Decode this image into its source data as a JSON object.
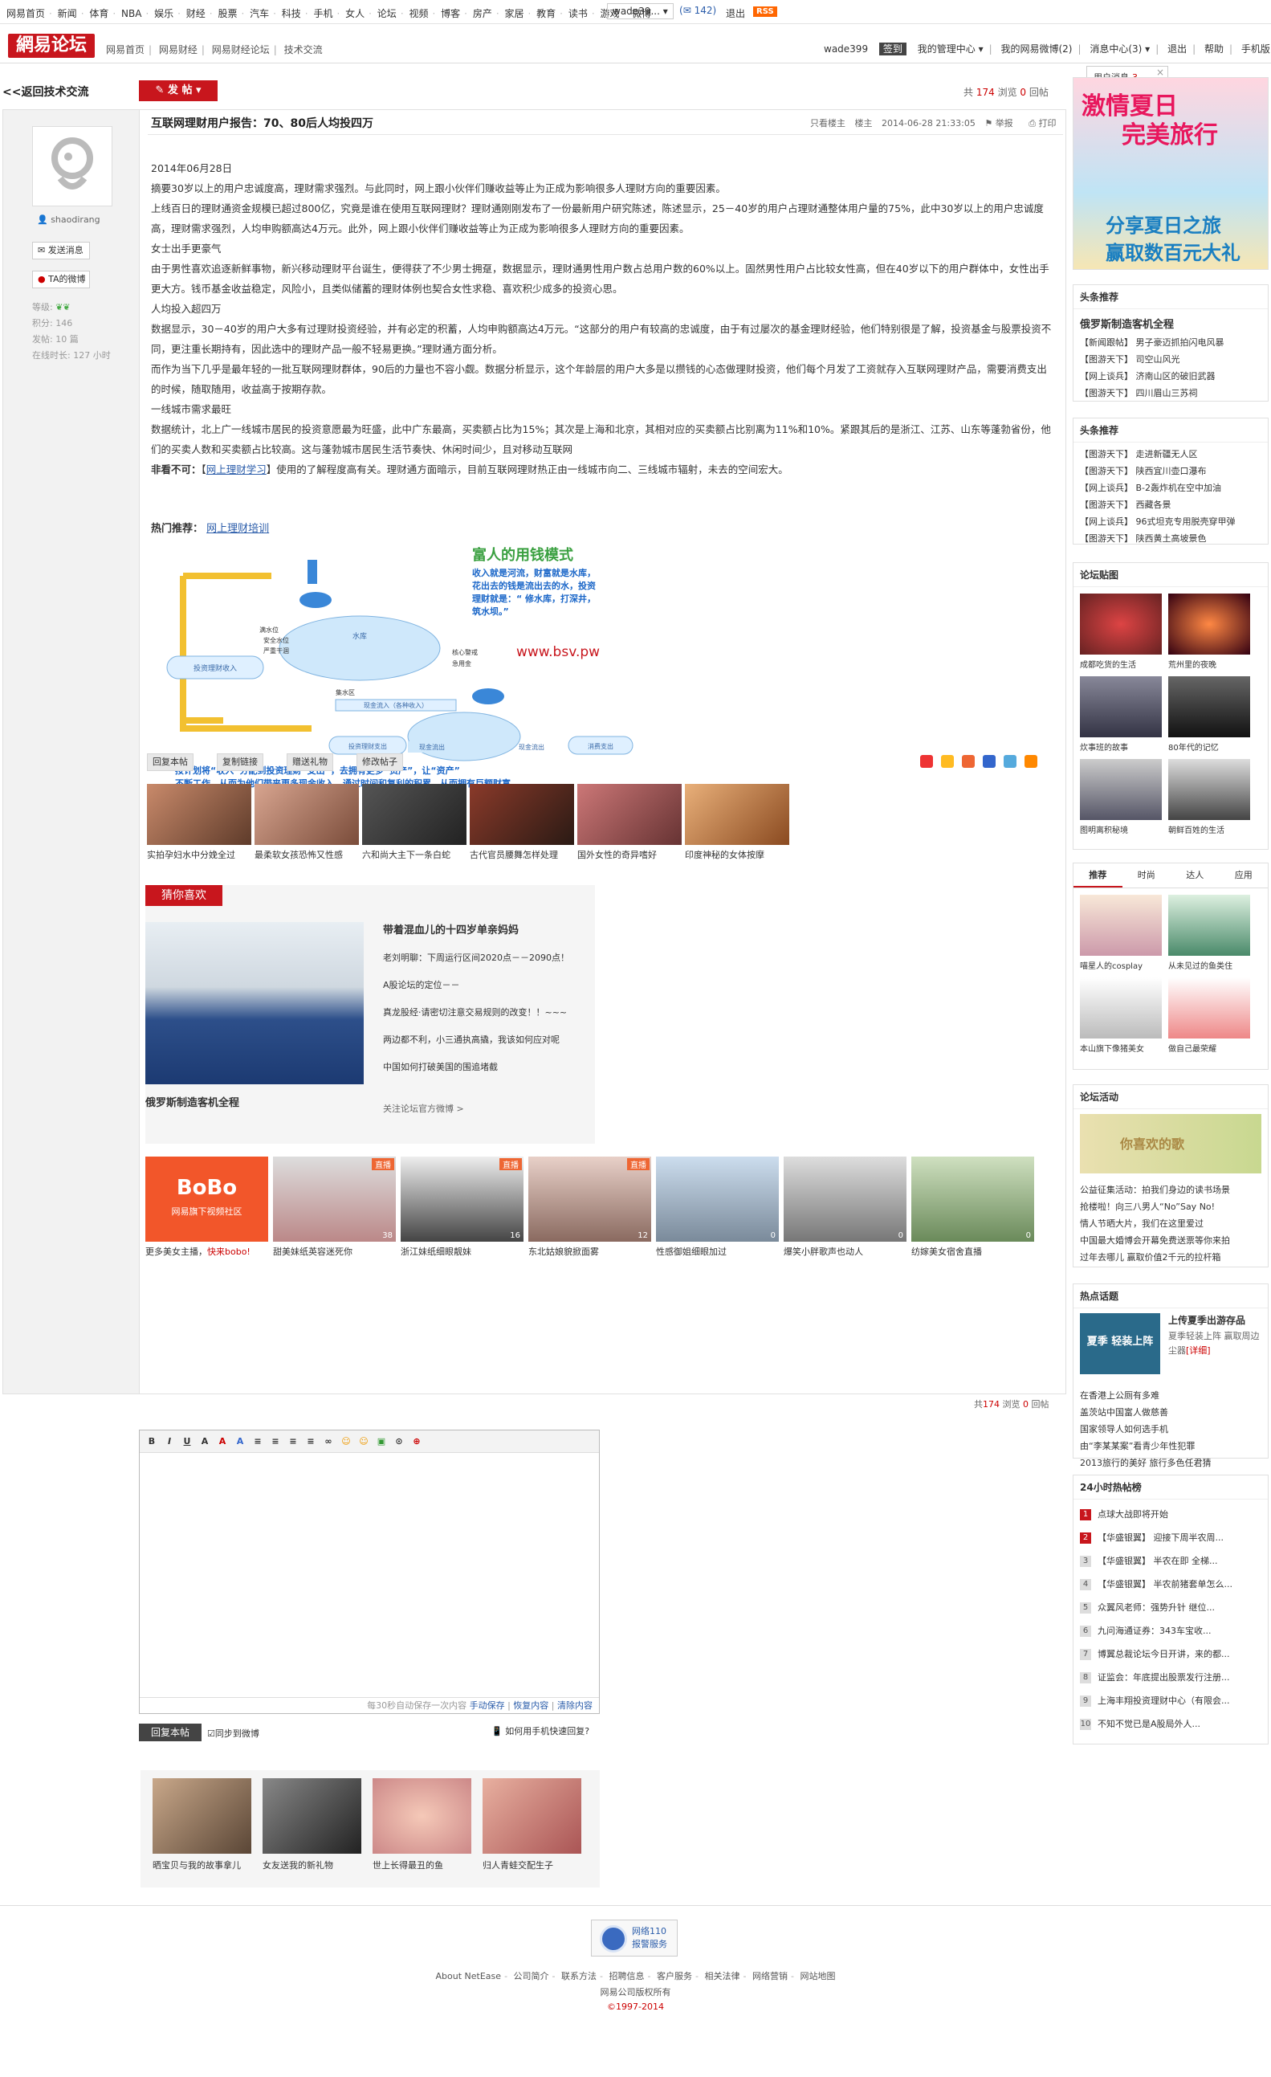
{
  "topnav": {
    "links": [
      "网易首页",
      "新闻",
      "体育",
      "NBA",
      "娱乐",
      "财经",
      "股票",
      "汽车",
      "科技",
      "手机",
      "女人",
      "论坛",
      "视频",
      "博客",
      "房产",
      "家居",
      "教育",
      "读书",
      "游戏",
      "微博"
    ],
    "user": "wade39...",
    "mail_count": "142",
    "logout": "退出",
    "rss": "RSS"
  },
  "header": {
    "logo": "網易论坛",
    "breadcrumb": [
      "网易首页",
      "网易财经",
      "网易财经论坛",
      "技术交流"
    ],
    "username": "wade399",
    "sign_badge": "签到",
    "menu": [
      "我的管理中心",
      "我的网易微博(2)",
      "消息中心(3)",
      "退出",
      "帮助",
      "手机版"
    ]
  },
  "msgpop": {
    "label": "用户消息",
    "count": "3",
    "close": "×"
  },
  "toolbar": {
    "back": "<<返回技术交流",
    "post": "发 帖"
  },
  "stats": {
    "total_label": "共",
    "views": "174",
    "views_label": "浏览",
    "replies": "0",
    "replies_label": "回帖"
  },
  "post": {
    "title": "互联网理财用户报告：70、80后人均投四万",
    "meta": {
      "only_author": "只看楼主",
      "floor": "楼主",
      "time": "2014-06-28 21:33:05",
      "report": "举报",
      "print": "打印"
    },
    "author": {
      "name": "shaodirang",
      "send_msg": "发送消息",
      "weibo": "TA的微博",
      "level_label": "等级:",
      "points_label": "积分:",
      "points": "146",
      "posts_label": "发帖:",
      "posts": "10 篇",
      "online_label": "在线时长:",
      "online": "127 小时"
    },
    "paragraphs": [
      "2014年06月28日",
      "摘要30岁以上的用户忠诚度高，理财需求强烈。与此同时，网上跟小伙伴们赚收益等止为正成为影响很多人理财方向的重要因素。",
      "上线百日的理财通资金规模已超过800亿，究竟是谁在使用互联网理财？理财通刚刚发布了一份最新用户研究陈述，陈述显示，25－40岁的用户占理财通整体用户量的75%，此中30岁以上的用户忠诚度高，理财需求强烈，人均申购额高达4万元。此外，网上跟小伙伴们赚收益等止为正成为影响很多人理财方向的重要因素。",
      "女士出手更豪气",
      "由于男性喜欢追逐新鲜事物，新兴移动理财平台诞生，便得获了不少男士拥趸，数据显示，理财通男性用户数占总用户数的60%以上。固然男性用户占比较女性高，但在40岁以下的用户群体中，女性出手更大方。钱币基金收益稳定，风险小，且类似储蓄的理财体例也契合女性求稳、喜欢积少成多的投资心思。",
      "人均投入超四万",
      "数据显示，30－40岁的用户大多有过理财投资经验，并有必定的积蓄，人均申购额高达4万元。“这部分的用户有较高的忠诚度，由于有过屡次的基金理财经验，他们特别很是了解，投资基金与股票投资不同，更注重长期持有，因此选中的理财产品一般不轻易更换。”理财通方面分析。",
      "而作为当下几乎是最年轻的一批互联网理财群体，90后的力量也不容小觑。数据分析显示，这个年龄层的用户大多是以攒钱的心态做理财投资，他们每个月发了工资就存入互联网理财产品，需要消费支出的时候，随取随用，收益高于按期存款。",
      "一线城市需求最旺",
      "数据统计，北上广一线城市居民的投资意愿最为旺盛，此中广东最高，买卖额占比为15%；其次是上海和北京，其相对应的买卖额占比别离为11%和10%。紧跟其后的是浙江、江苏、山东等蓬勃省份，他们的买卖人数和买卖额占比较高。这与蓬勃城市居民生活节奏快、休闲时间少，且对移动互联网"
    ],
    "closing": {
      "label": "非看不可：",
      "link": "网上理财学习",
      "rest": "】使用的了解程度高有关。理财通方面暗示，目前互联网理财热正由一线城市向二、三线城市辐射，未去的空间宏大。"
    },
    "hot": {
      "label": "热门推荐：",
      "link": "网上理财培训"
    },
    "infographic": {
      "heading": "富人的用钱模式",
      "lines": [
        "收入就是河流，财富就是水库，",
        "花出去的钱是流出去的水，投资",
        "理财就是：“ 修水库，打深井，",
        "筑水坝。”"
      ],
      "watermark": "www.bsv.pw",
      "boxes": [
        "投资理财收入",
        "水库",
        "现金流入（各种收入）",
        "投资理财支出",
        "现金流出",
        "消费支出"
      ],
      "side_labels": [
        "满水位",
        "安全水位",
        "严重干涸",
        "核心警戒",
        "急用金",
        "集水区",
        "现金流出"
      ],
      "bottom": [
        "按计划将“收入”分配到投资理财“支出”，去拥有更多“资产”，让“资产”",
        "不断工作，从而为他们带来更多现金收入，通过时间和复利的积累，从而拥有巨额财富。"
      ]
    },
    "actions": [
      "回复本帖",
      "复制链接",
      "赠送礼物",
      "修改帖子"
    ]
  },
  "pic_row": [
    "实拍孕妇水中分娩全过",
    "最柔软女孩恐怖又性感",
    "六和尚大主下一条白蛇",
    "古代官员腰舞怎样处理",
    "国外女性的奇异嗜好",
    "印度神秘的女体按摩"
  ],
  "guess": {
    "tab": "猜你喜欢",
    "caption": "俄罗斯制造客机全程",
    "headline": "带着混血儿的十四岁单亲妈妈",
    "items": [
      "老刘明聊：下周运行区间2020点－－2090点！",
      "A股论坛的定位－－",
      "真龙股经·请密切注意交易规则的改变！！~~~",
      "两边都不利，小三通执高撬，我该如何应对呢",
      "中国如何打破美国的围追堵截"
    ],
    "follow": "关注论坛官方微博 >"
  },
  "live_row": [
    {
      "cap_a": "更多美女主播，",
      "cap_b": "快来bobo!",
      "logo": "BoBo",
      "sub": "网易旗下视频社区"
    },
    {
      "cap_a": "甜美妹纸英容迷死你",
      "badge": "直播",
      "cnt": "38"
    },
    {
      "cap_a": "浙江妹纸细眼靓妹",
      "badge": "直播",
      "cnt": "16"
    },
    {
      "cap_a": "东北姑娘貌掀面雾",
      "badge": "直播",
      "cnt": "12"
    },
    {
      "cap_a": "性感御姐细眼加过",
      "cnt": "0"
    },
    {
      "cap_a": "爆笑小胖歌声也动人",
      "cnt": "0"
    },
    {
      "cap_a": "纺嫁美女宿舍直播",
      "cnt": "0"
    }
  ],
  "editor": {
    "tools": [
      "B",
      "I",
      "U",
      "A",
      "A",
      "A",
      "≡",
      "≡",
      "≡",
      "≡",
      "∞",
      "☺",
      "☺",
      "▣",
      "⊙",
      "⊕"
    ],
    "autosave": "每30秒自动保存一次内容",
    "save": "手动保存",
    "restore": "恢复内容",
    "clear": "清除内容",
    "reply": "回复本帖",
    "sync": "同步到微博",
    "mobile": "如何用手机快速回复?"
  },
  "related": [
    "晒宝贝与我的故事拿儿",
    "女友送我的新礼物",
    "世上长得最丑的鱼",
    "归人青蛙交配生子"
  ],
  "footer": {
    "police_line1": "网络110",
    "police_line2": "报警服务",
    "links": [
      "About NetEase",
      "公司简介",
      "联系方法",
      "招聘信息",
      "客户服务",
      "相关法律",
      "网络营销",
      "网站地图"
    ],
    "copy": "网易公司版权所有",
    "year": "©1997-2014"
  },
  "sidebar": {
    "ad": {
      "line1": "激情夏日",
      "line2": "完美旅行",
      "line3": "分享夏日之旅",
      "line4": "赢取数百元大礼"
    },
    "headline1": {
      "title": "头条推荐",
      "featured": "俄罗斯制造客机全程",
      "items": [
        "【新闻跟帖】 男子豪迈抓拍闪电风暴",
        "【图游天下】 司空山风光",
        "【网上谈兵】 济南山区的破旧武器",
        "【图游天下】 四川眉山三苏祠"
      ]
    },
    "headline2": {
      "title": "头条推荐",
      "items": [
        "【图游天下】 走进新疆无人区",
        "【图游天下】 陕西宜川壶口瀑布",
        "【网上谈兵】 B-2轰炸机在空中加油",
        "【图游天下】 西藏各景",
        "【网上谈兵】 96式坦克专用脱壳穿甲弹",
        "【图游天下】 陕西黄土高坡景色"
      ]
    },
    "photos": {
      "title": "论坛贴图",
      "items": [
        "成都吃货的生活",
        "荒州里的夜晚",
        "炊事班的故事",
        "80年代的记忆",
        "图明离积秘境",
        "朝鲜百姓的生活"
      ]
    },
    "tabs": [
      "推荐",
      "时尚",
      "达人",
      "应用"
    ],
    "tab_items": [
      "喵星人的cosplay",
      "从未见过的鱼类住",
      "本山旗下像猪美女",
      "做自己最荣耀"
    ],
    "activity": {
      "title": "论坛活动",
      "banner": "你喜欢的歌",
      "items": [
        "公益征集活动：拍我们身边的读书场景",
        "抢楼啦！向三八男人“No”Say No!",
        "情人节晒大片，我们在这里爱过",
        "中国最大婚博会开幕免费送票等你来拍",
        "过年去哪儿 赢取价值2千元的拉杆箱"
      ]
    },
    "hot": {
      "title": "热点话题",
      "featured": "上传夏季出游存品",
      "desc": "夏季轻装上阵 赢取周边尘器",
      "link": "[详细]",
      "badge": "夏季 轻装上阵",
      "items": [
        "在香港上公厕有多难",
        "盖茨站中国富人做慈善",
        "国家领导人如何选手机",
        "由“李某某案”看青少年性犯罪",
        "2013旅行的美好 旅行多色任君猜"
      ]
    },
    "rank": {
      "title": "24小时热帖榜",
      "items": [
        "点球大战即将开始",
        "【华盛银翼】 迎接下周半农周...",
        "【华盛银翼】 半农在即 全梯...",
        "【华盛银翼】 半农前猪套单怎么...",
        "众翼风老师：强势升针 继位...",
        "九问海通证券：343车宝收...",
        "博翼总裁论坛今日开讲，来的都...",
        "证监会：年底提出股票发行注册...",
        "上海丰翔投资理财中心（有限会...",
        "不知不觉已是A股局外人..."
      ]
    }
  }
}
